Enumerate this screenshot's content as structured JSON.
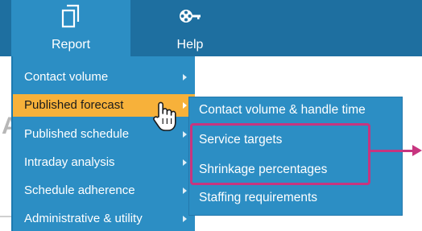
{
  "toolbar": {
    "buttons": [
      {
        "label": "Report",
        "icon": "report-document-icon"
      },
      {
        "label": "Help",
        "icon": "help-film-key-icon"
      }
    ]
  },
  "menu": {
    "items": [
      {
        "label": "Contact volume",
        "active": false
      },
      {
        "label": "Published forecast",
        "active": true
      },
      {
        "label": "Published schedule",
        "active": false
      },
      {
        "label": "Intraday analysis",
        "active": false
      },
      {
        "label": "Schedule adherence",
        "active": false
      },
      {
        "label": "Administrative & utility",
        "active": false
      }
    ]
  },
  "submenu": {
    "items": [
      {
        "label": "Contact volume & handle time"
      },
      {
        "label": "Service targets"
      },
      {
        "label": "Shrinkage percentages"
      },
      {
        "label": "Staffing requirements"
      }
    ]
  },
  "background": {
    "ghost_letter": "A"
  },
  "colors": {
    "toolbar": "#1e6fa0",
    "menu": "#2c8ec4",
    "active_item": "#f7b13a",
    "highlight": "#c7357f"
  }
}
